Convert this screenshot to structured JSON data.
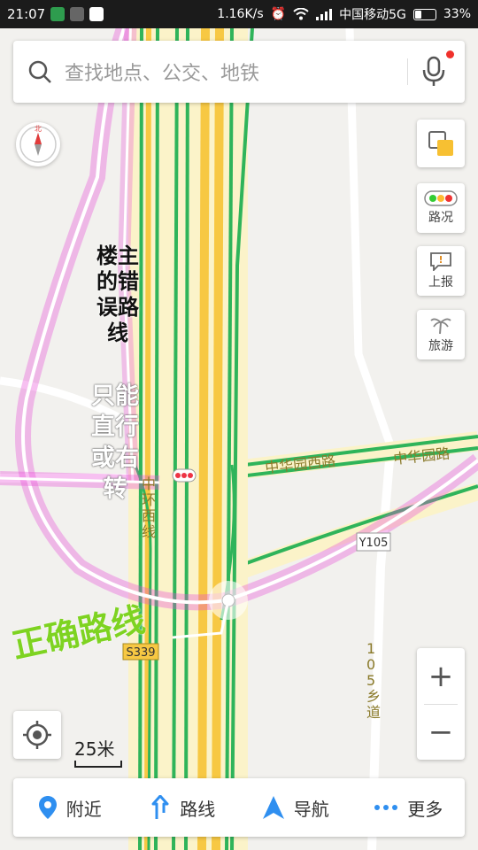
{
  "status_bar": {
    "time": "21:07",
    "speed": "1.16K/s",
    "carrier": "中国移动5G",
    "battery": "33%"
  },
  "search": {
    "placeholder": "查找地点、公交、地铁"
  },
  "right_controls": {
    "traffic_label": "路况",
    "report_label": "上报",
    "travel_label": "旅游"
  },
  "compass": {
    "north_label": "北"
  },
  "zoom": {
    "in_label": "+",
    "out_label": "−"
  },
  "scale": {
    "label": "25米"
  },
  "bottom_nav": [
    {
      "label": "附近",
      "icon": "location-pin-icon"
    },
    {
      "label": "路线",
      "icon": "route-arrow-icon"
    },
    {
      "label": "导航",
      "icon": "navigation-arrow-icon"
    },
    {
      "label": "更多",
      "icon": "more-dots-icon"
    }
  ],
  "map_labels": {
    "road_zhonghuayuan_west": "中华园西路",
    "road_zhonghuayuan": "中华园路",
    "road_zhonghuanxi": "中环西线",
    "road_y105": "Y105",
    "road_s339": "S339",
    "road_105_village": "105乡道"
  },
  "annotations": {
    "wrong_route": "楼主的错误路线",
    "only_straight_right": "只能直行或右转",
    "correct_route": "正确路线"
  },
  "colors": {
    "highway_yellow": "#f7c843",
    "traffic_green": "#2fb45a",
    "route_pink": "#e84bd6",
    "accent_blue": "#2f8ff0"
  }
}
